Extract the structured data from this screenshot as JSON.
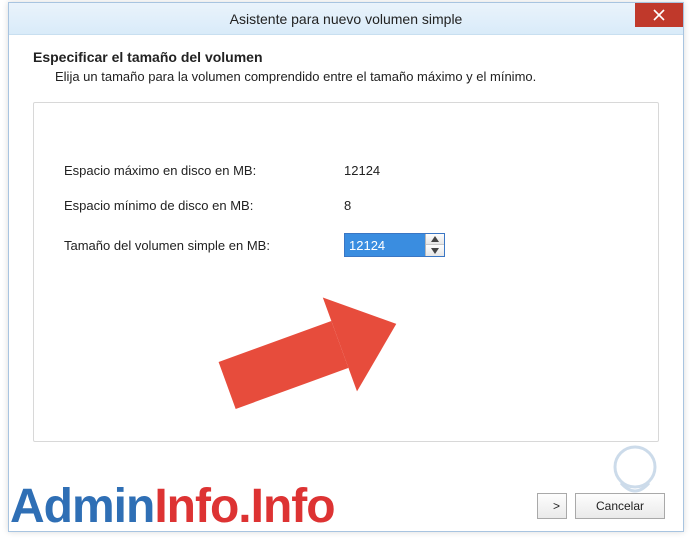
{
  "window": {
    "title": "Asistente para nuevo volumen simple"
  },
  "page": {
    "heading": "Especificar el tamaño del volumen",
    "subheading": "Elija un tamaño para la volumen comprendido entre el tamaño máximo y el mínimo."
  },
  "fields": {
    "max_label": "Espacio máximo en disco en MB:",
    "max_value": "12124",
    "min_label": "Espacio mínimo de disco en MB:",
    "min_value": "8",
    "size_label": "Tamaño del volumen simple en MB:",
    "size_value": "12124"
  },
  "buttons": {
    "cancel": "Cancelar"
  },
  "watermark": {
    "left": "Admin",
    "right": "Info.Info"
  }
}
